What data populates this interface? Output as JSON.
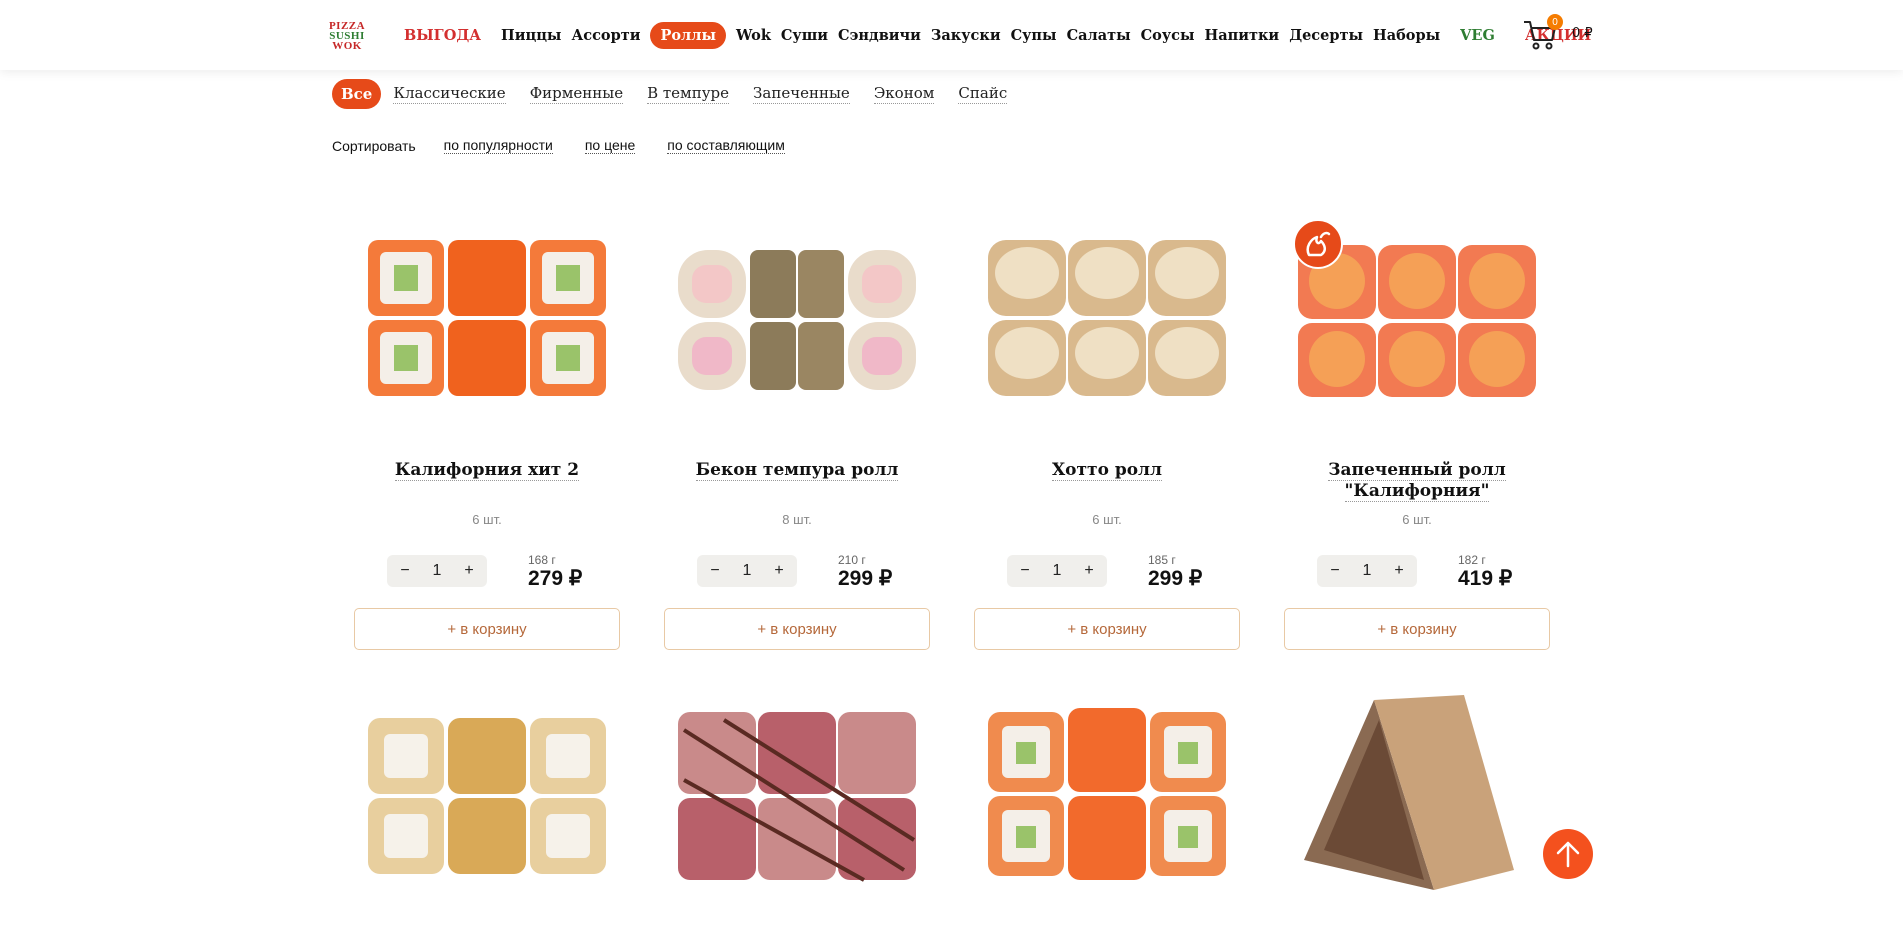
{
  "logo": {
    "line1": "PIZZA",
    "line2": "SUSHI",
    "line3": "WOK"
  },
  "nav": [
    {
      "label": "ВЫГОДА",
      "style": "red"
    },
    {
      "label": "Пиццы",
      "style": "normal"
    },
    {
      "label": "Ассорти",
      "style": "normal"
    },
    {
      "label": "Роллы",
      "style": "active"
    },
    {
      "label": "Wok",
      "style": "normal"
    },
    {
      "label": "Суши",
      "style": "normal"
    },
    {
      "label": "Сэндвичи",
      "style": "normal"
    },
    {
      "label": "Закуски",
      "style": "normal"
    },
    {
      "label": "Супы",
      "style": "normal"
    },
    {
      "label": "Салаты",
      "style": "normal"
    },
    {
      "label": "Соусы",
      "style": "normal"
    },
    {
      "label": "Напитки",
      "style": "normal"
    },
    {
      "label": "Десерты",
      "style": "normal"
    },
    {
      "label": "Наборы",
      "style": "normal"
    },
    {
      "label": "VEG",
      "style": "green"
    },
    {
      "label": "АКЦИИ",
      "style": "red"
    }
  ],
  "cart": {
    "count": "0",
    "total": "0 ₽",
    "icon": "cart-icon"
  },
  "subcategories": [
    "Все",
    "Классические",
    "Фирменные",
    "В темпуре",
    "Запеченные",
    "Эконом",
    "Спайс"
  ],
  "sort": {
    "label": "Сортировать",
    "options": [
      "по популярности",
      "по цене",
      "по составляющим"
    ]
  },
  "products": [
    {
      "title": "Калифорния хит 2",
      "pieces": "6 шт.",
      "qty": "1",
      "weight": "168 г",
      "price": "279 ₽",
      "add": "+ в корзину"
    },
    {
      "title": "Бекон темпура ролл",
      "pieces": "8 шт.",
      "qty": "1",
      "weight": "210 г",
      "price": "299 ₽",
      "add": "+ в корзину"
    },
    {
      "title": "Хотто ролл",
      "pieces": "6 шт.",
      "qty": "1",
      "weight": "185 г",
      "price": "299 ₽",
      "add": "+ в корзину"
    },
    {
      "title": "Запеченный ролл \"Калифорния\"",
      "pieces": "6 шт.",
      "qty": "1",
      "weight": "182 г",
      "price": "419 ₽",
      "add": "+ в корзину"
    }
  ],
  "accent": "#e64a19"
}
